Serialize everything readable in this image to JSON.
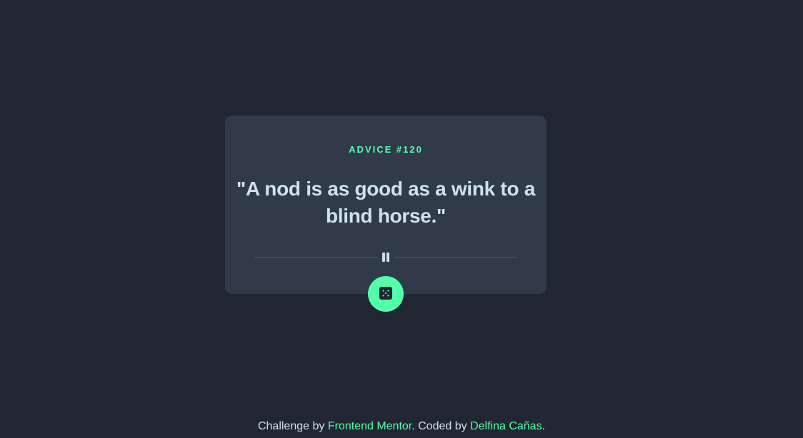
{
  "card": {
    "advice_label": "ADVICE #120",
    "quote": "\"A nod is as good as a wink to a blind horse.\""
  },
  "icons": {
    "divider": "pause-icon",
    "generate": "dice-icon"
  },
  "footer": {
    "challenge_prefix": "Challenge by",
    "challenge_link": "Frontend Mentor",
    "coded_prefix": ". Coded by",
    "author_link": "Delfina Cañas",
    "suffix": "."
  },
  "colors": {
    "background": "#202632",
    "card": "#313a48",
    "accent": "#53ffaa",
    "text": "#cee3e9",
    "divider": "#4f5d74"
  }
}
